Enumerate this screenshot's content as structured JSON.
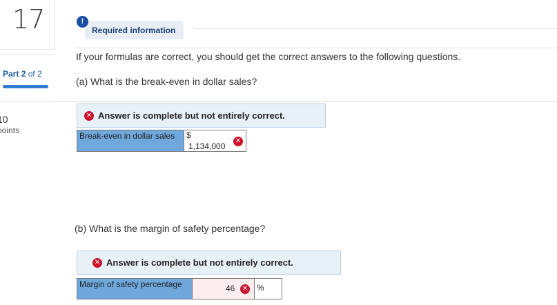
{
  "question": {
    "number": "17",
    "part_current": "2",
    "part_text": "of 2",
    "part_prefix": "Part",
    "points_value": "10",
    "points_label": "points"
  },
  "required": {
    "icon": "!",
    "label": "Required information"
  },
  "intro": "If your formulas are correct, you should get the correct answers to the following questions.",
  "part_a": {
    "question": "(a) What is the break-even in dollar sales?",
    "banner": "Answer is complete but not entirely correct.",
    "label": "Break-even in dollar sales",
    "currency": "$",
    "value": "1,134,000"
  },
  "part_b": {
    "question": "(b) What is the margin of safety percentage?",
    "banner": "Answer is complete but not entirely correct.",
    "label": "Margin of safety percentage",
    "value": "46",
    "unit": "%"
  },
  "icons": {
    "incorrect": "✕"
  },
  "colors": {
    "accent_blue": "#2f7bd6",
    "label_cell": "#6fa8dc",
    "banner_bg": "#e8f0f8",
    "error_red": "#d0112b",
    "wrong_cell_bg": "#fdeeed"
  }
}
